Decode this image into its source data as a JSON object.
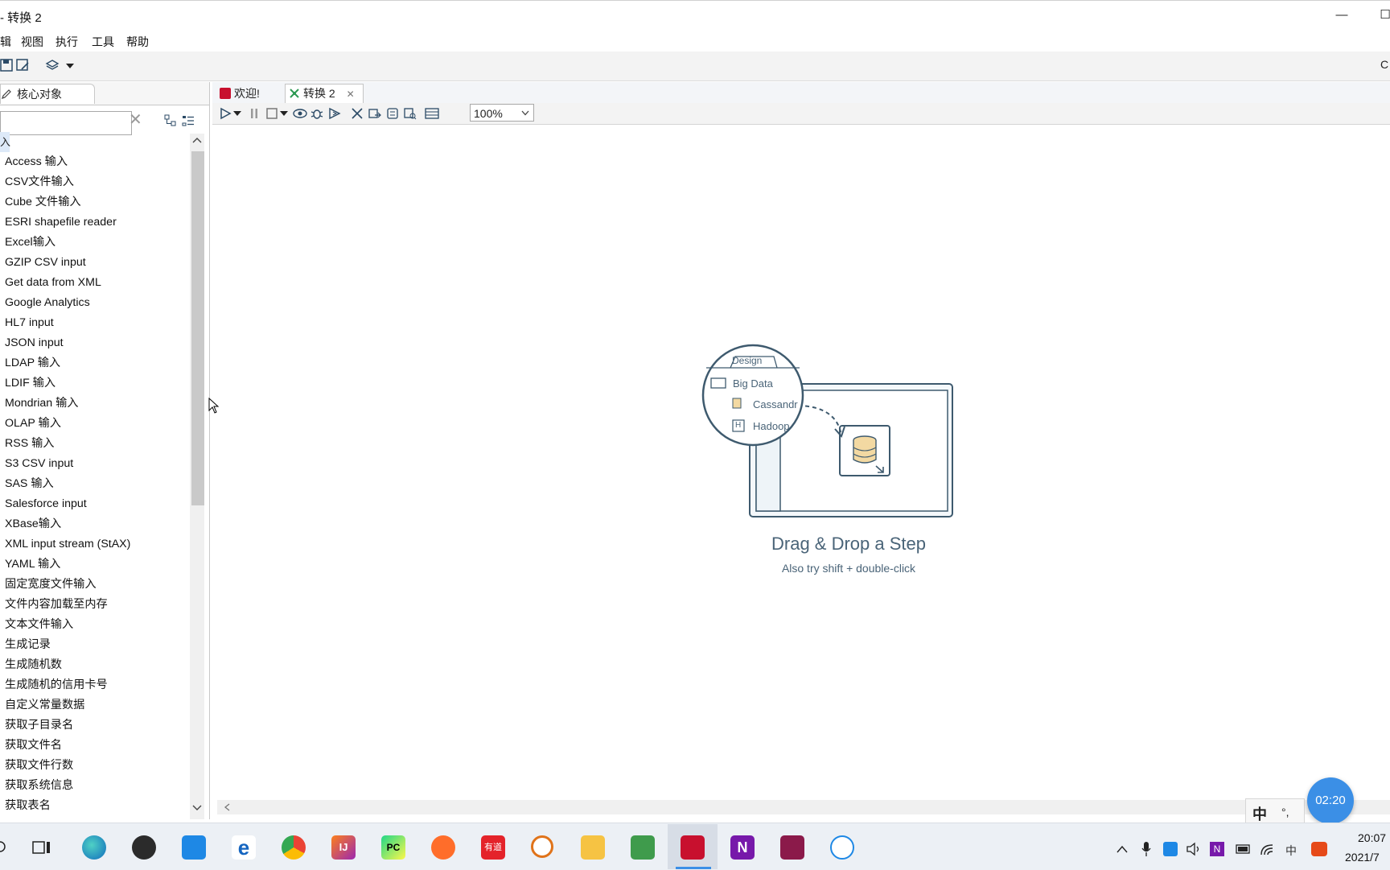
{
  "window": {
    "title": "- 转换 2",
    "partial_right_label": "C"
  },
  "menu": [
    "辑",
    "视图",
    "执行",
    "工具",
    "帮助"
  ],
  "left_panel": {
    "tab_label": "核心对象",
    "search_placeholder": "",
    "category_partial": "入",
    "items": [
      "Access 输入",
      "CSV文件输入",
      "Cube 文件输入",
      "ESRI shapefile reader",
      "Excel输入",
      "GZIP CSV input",
      "Get data from XML",
      "Google Analytics",
      "HL7 input",
      "JSON input",
      "LDAP 输入",
      "LDIF 输入",
      "Mondrian 输入",
      "OLAP 输入",
      "RSS 输入",
      "S3 CSV input",
      "SAS 输入",
      "Salesforce input",
      "XBase输入",
      "XML input stream (StAX)",
      "YAML 输入",
      "固定宽度文件输入",
      "文件内容加载至内存",
      "文本文件输入",
      "生成记录",
      "生成随机数",
      "生成随机的信用卡号",
      "自定义常量数据",
      "获取子目录名",
      "获取文件名",
      "获取文件行数",
      "获取系统信息",
      "获取表名"
    ]
  },
  "editor": {
    "tabs": [
      {
        "label": "欢迎!",
        "active": false
      },
      {
        "label": "转换 2",
        "active": true
      }
    ],
    "zoom": "100%"
  },
  "illustration": {
    "design_tab": "Design",
    "folder_label": "Big Data",
    "item1": "Cassandr",
    "item2": "Hadoop",
    "h_badge": "H",
    "title": "Drag & Drop a Step",
    "subtitle": "Also try shift + double-click"
  },
  "overlay": {
    "timer": "02:20",
    "ime_char": "中",
    "ime_punct": "°,"
  },
  "taskbar": {
    "youdao_label": "有道",
    "tray_ime": "中",
    "clock_time": "20:07",
    "clock_date": "2021/7"
  },
  "colors": {
    "accent_blue": "#3b8fe6",
    "illustration_stroke": "#3e5a6e",
    "illustration_text": "#4a6478",
    "pentaho_red": "#c8102e"
  }
}
